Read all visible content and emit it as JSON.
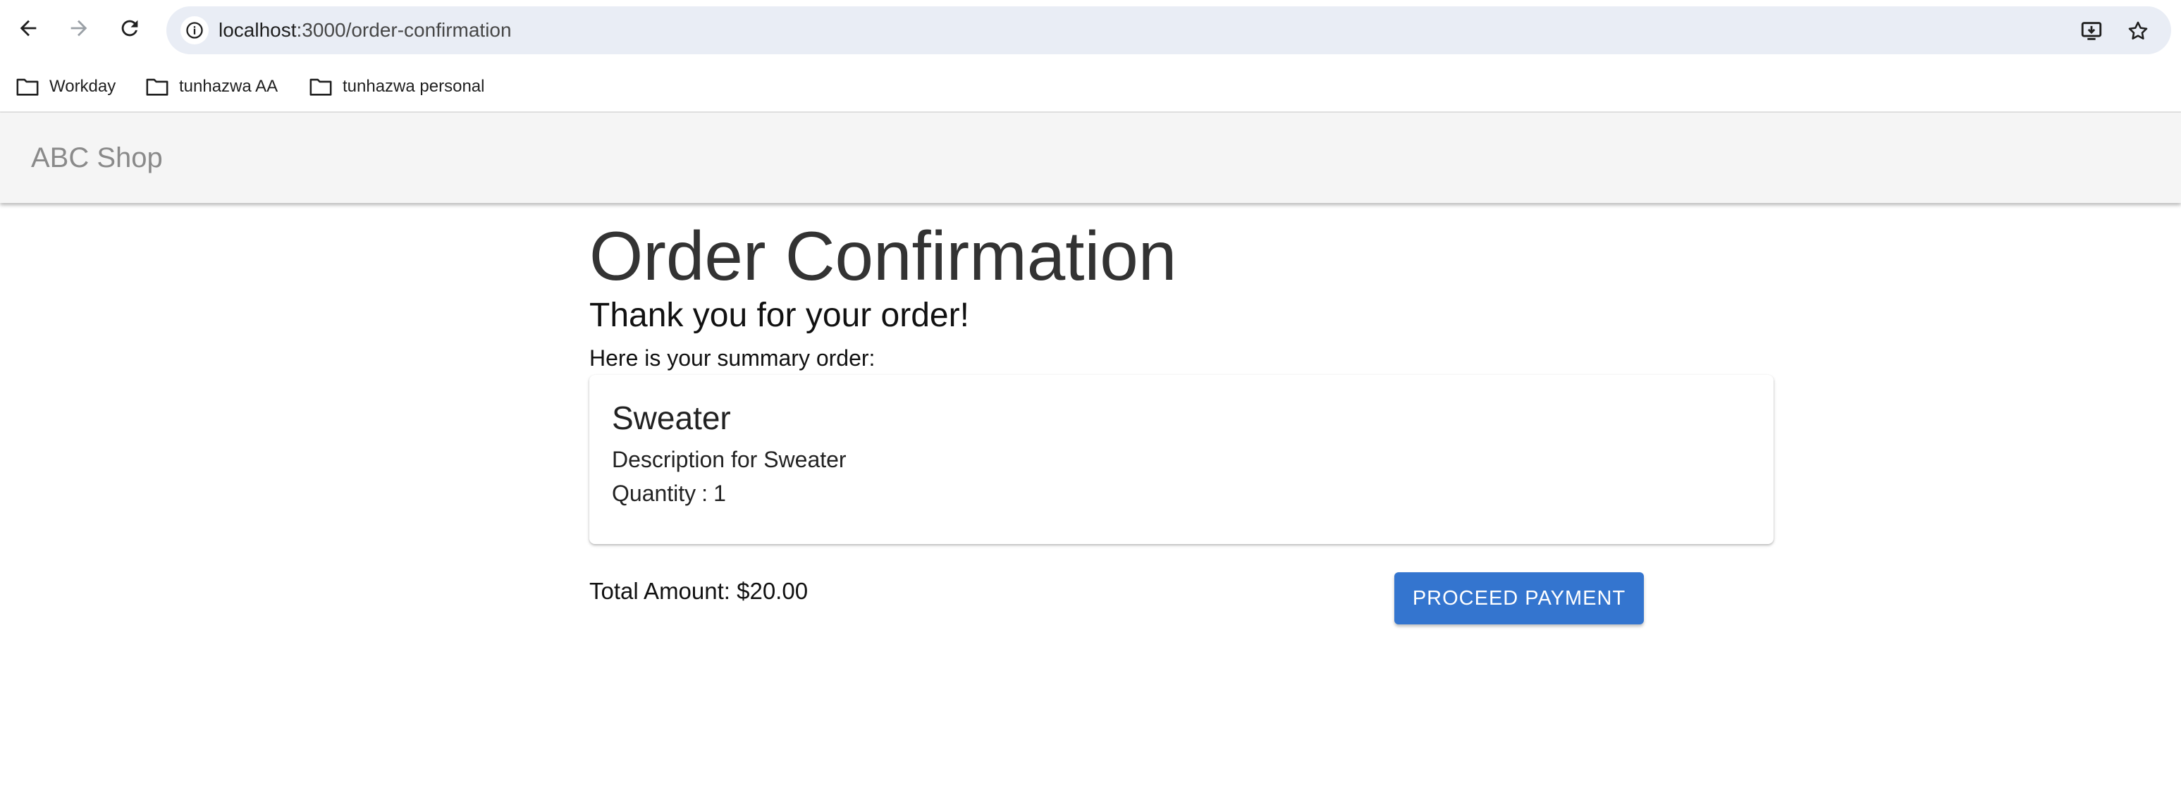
{
  "browser": {
    "url_host": "localhost",
    "url_path": ":3000/order-confirmation",
    "back_icon": "arrow-left-icon",
    "forward_icon": "arrow-right-icon",
    "reload_icon": "reload-icon",
    "site_info_icon": "info-icon",
    "install_icon": "install-app-icon",
    "bookmark_icon": "star-icon"
  },
  "bookmarks": [
    {
      "label": "Workday",
      "icon": "folder-icon"
    },
    {
      "label": "tunhazwa AA",
      "icon": "folder-icon"
    },
    {
      "label": "tunhazwa personal",
      "icon": "folder-icon"
    }
  ],
  "app": {
    "title": "ABC Shop"
  },
  "page": {
    "title": "Order Confirmation",
    "thanks": "Thank you for your order!",
    "summary_label": "Here is your summary order:"
  },
  "order": {
    "item_name": "Sweater",
    "item_description": "Description for Sweater",
    "quantity_label": "Quantity",
    "quantity_sep": ":",
    "quantity_value": "1"
  },
  "summary": {
    "total_label": "Total Amount:",
    "total_value": "$20.00",
    "proceed_label": "PROCEED PAYMENT"
  },
  "colors": {
    "primary": "#3475cf",
    "header_bg": "#f5f5f5",
    "omnibox_bg": "#e9edf5"
  }
}
